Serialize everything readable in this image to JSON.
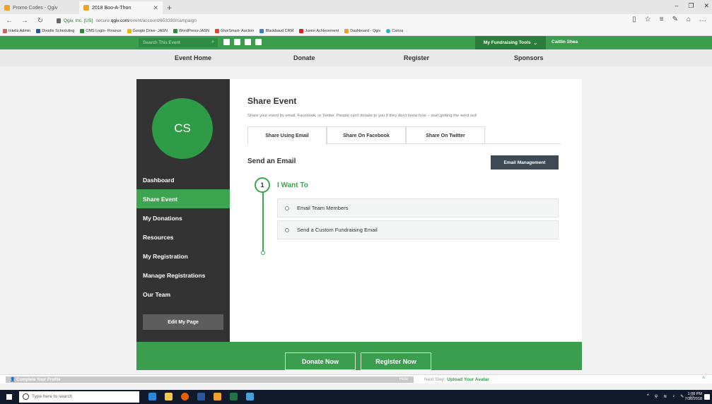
{
  "browser": {
    "tabs": [
      {
        "label": "Promo Codes - Qgiv",
        "active": false
      },
      {
        "label": "2018 Boo-A-Thon",
        "active": true
      }
    ],
    "new_tab_symbol": "+",
    "url_site": "Qgiv, Inc. [US]",
    "url_prefix": "secure.",
    "url_host": "qgiv.com",
    "url_path": "/event/account/653330/campaign",
    "favorites": [
      "Intelis Admin",
      "Doodle Scheduling",
      "CMS Login- Finance",
      "Google Drive- JASN",
      "WordPress-JASN",
      "GiveSmart- Auction",
      "Blackbaud CRM",
      "Junior Achievement",
      "Dashboard - Qgiv",
      "Canva"
    ]
  },
  "site_header": {
    "search_placeholder": "Search This Event",
    "fundraising_tools": "My Fundraising Tools",
    "user_name": "Caitlin Shea"
  },
  "site_nav": [
    "Event Home",
    "Donate",
    "Register",
    "Sponsors"
  ],
  "sidebar": {
    "avatar_initials": "CS",
    "items": [
      {
        "label": "Dashboard",
        "active": false
      },
      {
        "label": "Share Event",
        "active": true
      },
      {
        "label": "My Donations",
        "active": false
      },
      {
        "label": "Resources",
        "active": false
      },
      {
        "label": "My Registration",
        "active": false
      },
      {
        "label": "Manage Registrations",
        "active": false
      },
      {
        "label": "Our Team",
        "active": false
      }
    ],
    "edit_button": "Edit My Page"
  },
  "main": {
    "title": "Share Event",
    "description": "Share your event by email, Facebook, or Twitter. People can't donate to you if they don't know how – start getting the word out!",
    "tabs": [
      "Share Using Email",
      "Share On Facebook",
      "Share On Twitter"
    ],
    "section_title": "Send an Email",
    "email_management": "Email Management",
    "step_number": "1",
    "step_title": "I Want To",
    "options": [
      "Email Team Members",
      "Send a Custom Fundraising Email"
    ]
  },
  "footer": {
    "donate_button": "Donate Now",
    "register_button": "Register Now"
  },
  "profile_bar": {
    "label": "Complete Your Profile",
    "hide": "Hide",
    "next_step_prefix": "Next Step:",
    "next_step_link": "Upload Your Avatar"
  },
  "taskbar": {
    "search_placeholder": "Type here to search",
    "time": "1:08 PM",
    "date": "7/30/2018"
  }
}
